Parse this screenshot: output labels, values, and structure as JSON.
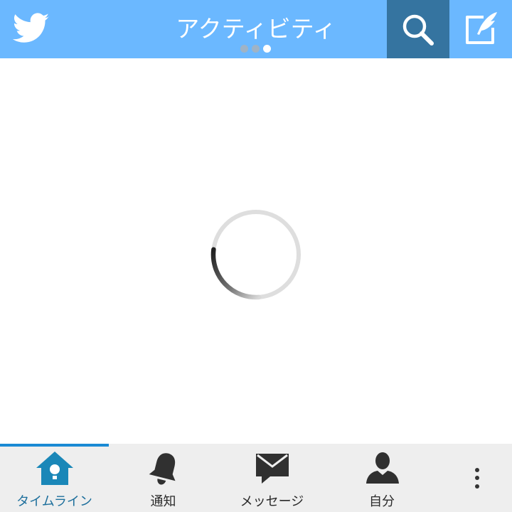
{
  "header": {
    "title": "アクティビティ",
    "page_count": 3,
    "active_page": 3,
    "search_icon": "search-icon",
    "compose_icon": "compose-icon",
    "logo_icon": "twitter-bird-icon"
  },
  "content": {
    "state": "loading",
    "spinner_icon": "loading-spinner"
  },
  "bottom_nav": {
    "tabs": [
      {
        "label": "タイムライン",
        "icon": "birdhouse-icon",
        "active": true
      },
      {
        "label": "通知",
        "icon": "bell-icon",
        "active": false
      },
      {
        "label": "メッセージ",
        "icon": "envelope-icon",
        "active": false
      },
      {
        "label": "自分",
        "icon": "person-icon",
        "active": false
      }
    ],
    "overflow_icon": "more-vertical-icon"
  },
  "colors": {
    "header_bg": "#6bb8ff",
    "search_bg": "#3574a0",
    "active_tab": "#1a8ad4",
    "nav_bg": "#eeeeee"
  }
}
